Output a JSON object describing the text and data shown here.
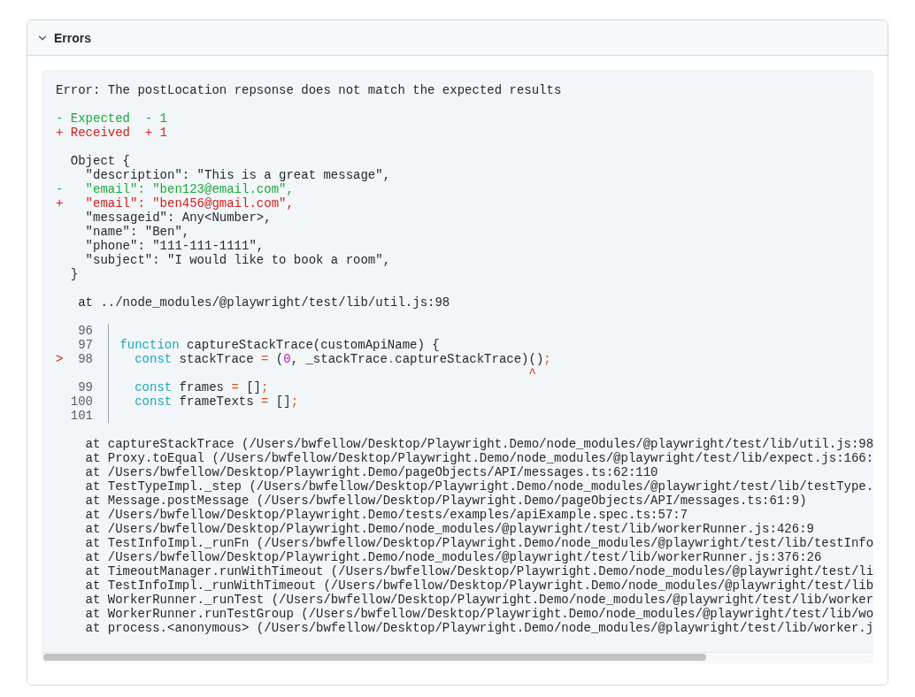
{
  "panel": {
    "title": "Errors",
    "expanded": true
  },
  "error": {
    "message": "Error: The postLocation repsonse does not match the expected results",
    "summary": [
      {
        "kind": "expected",
        "text": "- Expected  - 1"
      },
      {
        "kind": "received",
        "text": "+ Received  + 1"
      }
    ],
    "object": {
      "open": "Object {",
      "entries": [
        {
          "kind": "same",
          "text": "\"description\": \"This is a great message\","
        },
        {
          "kind": "removed",
          "sign": "-",
          "text": "\"email\": \"ben123@email.com\","
        },
        {
          "kind": "added",
          "sign": "+",
          "text": "\"email\": \"ben456@gmail.com\","
        },
        {
          "kind": "same",
          "text": "\"messageid\": Any<Number>,"
        },
        {
          "kind": "same",
          "text": "\"name\": \"Ben\","
        },
        {
          "kind": "same",
          "text": "\"phone\": \"111-111-1111\","
        },
        {
          "kind": "same",
          "text": "\"subject\": \"I would like to book a room\","
        }
      ],
      "close": "}"
    },
    "location": "at ../node_modules/@playwright/test/lib/util.js:98",
    "code_frame": [
      {
        "kind": "line",
        "number": "96"
      },
      {
        "kind": "line",
        "number": "97",
        "tokens": [
          {
            "kind": "keyword",
            "text": "function"
          },
          {
            "kind": "plain",
            "text": " captureStackTrace(customApiName) {"
          }
        ]
      },
      {
        "kind": "line",
        "number": "98",
        "marker": ">",
        "tokens": [
          {
            "kind": "keyword",
            "text": "  const"
          },
          {
            "kind": "plain",
            "text": " stackTrace "
          },
          {
            "kind": "punct",
            "text": "="
          },
          {
            "kind": "plain",
            "text": " ("
          },
          {
            "kind": "number",
            "text": "0"
          },
          {
            "kind": "plain",
            "text": ", _stackTrace"
          },
          {
            "kind": "punct",
            "text": "."
          },
          {
            "kind": "plain",
            "text": "captureStackTrace)()"
          },
          {
            "kind": "punct",
            "text": ";"
          }
        ]
      },
      {
        "kind": "caret",
        "text": "                                                       ^"
      },
      {
        "kind": "line",
        "number": "99",
        "tokens": [
          {
            "kind": "keyword",
            "text": "  const"
          },
          {
            "kind": "plain",
            "text": " frames "
          },
          {
            "kind": "punct",
            "text": "="
          },
          {
            "kind": "plain",
            "text": " []"
          },
          {
            "kind": "punct",
            "text": ";"
          }
        ]
      },
      {
        "kind": "line",
        "number": "100",
        "tokens": [
          {
            "kind": "keyword",
            "text": "  const"
          },
          {
            "kind": "plain",
            "text": " frameTexts "
          },
          {
            "kind": "punct",
            "text": "="
          },
          {
            "kind": "plain",
            "text": " []"
          },
          {
            "kind": "punct",
            "text": ";"
          }
        ]
      },
      {
        "kind": "line",
        "number": "101"
      }
    ],
    "stack": [
      "at captureStackTrace (/Users/bwfellow/Desktop/Playwright.Demo/node_modules/@playwright/test/lib/util.js:98",
      "at Proxy.toEqual (/Users/bwfellow/Desktop/Playwright.Demo/node_modules/@playwright/test/lib/expect.js:166:",
      "at /Users/bwfellow/Desktop/Playwright.Demo/pageObjects/API/messages.ts:62:110",
      "at TestTypeImpl._step (/Users/bwfellow/Desktop/Playwright.Demo/node_modules/@playwright/test/lib/testType.",
      "at Message.postMessage (/Users/bwfellow/Desktop/Playwright.Demo/pageObjects/API/messages.ts:61:9)",
      "at /Users/bwfellow/Desktop/Playwright.Demo/tests/examples/apiExample.spec.ts:57:7",
      "at /Users/bwfellow/Desktop/Playwright.Demo/node_modules/@playwright/test/lib/workerRunner.js:426:9",
      "at TestInfoImpl._runFn (/Users/bwfellow/Desktop/Playwright.Demo/node_modules/@playwright/test/lib/testInfo",
      "at /Users/bwfellow/Desktop/Playwright.Demo/node_modules/@playwright/test/lib/workerRunner.js:376:26",
      "at TimeoutManager.runWithTimeout (/Users/bwfellow/Desktop/Playwright.Demo/node_modules/@playwright/test/li",
      "at TestInfoImpl._runWithTimeout (/Users/bwfellow/Desktop/Playwright.Demo/node_modules/@playwright/test/lib",
      "at WorkerRunner._runTest (/Users/bwfellow/Desktop/Playwright.Demo/node_modules/@playwright/test/lib/worker",
      "at WorkerRunner.runTestGroup (/Users/bwfellow/Desktop/Playwright.Demo/node_modules/@playwright/test/lib/wo",
      "at process.<anonymous> (/Users/bwfellow/Desktop/Playwright.Demo/node_modules/@playwright/test/lib/worker.j"
    ]
  }
}
